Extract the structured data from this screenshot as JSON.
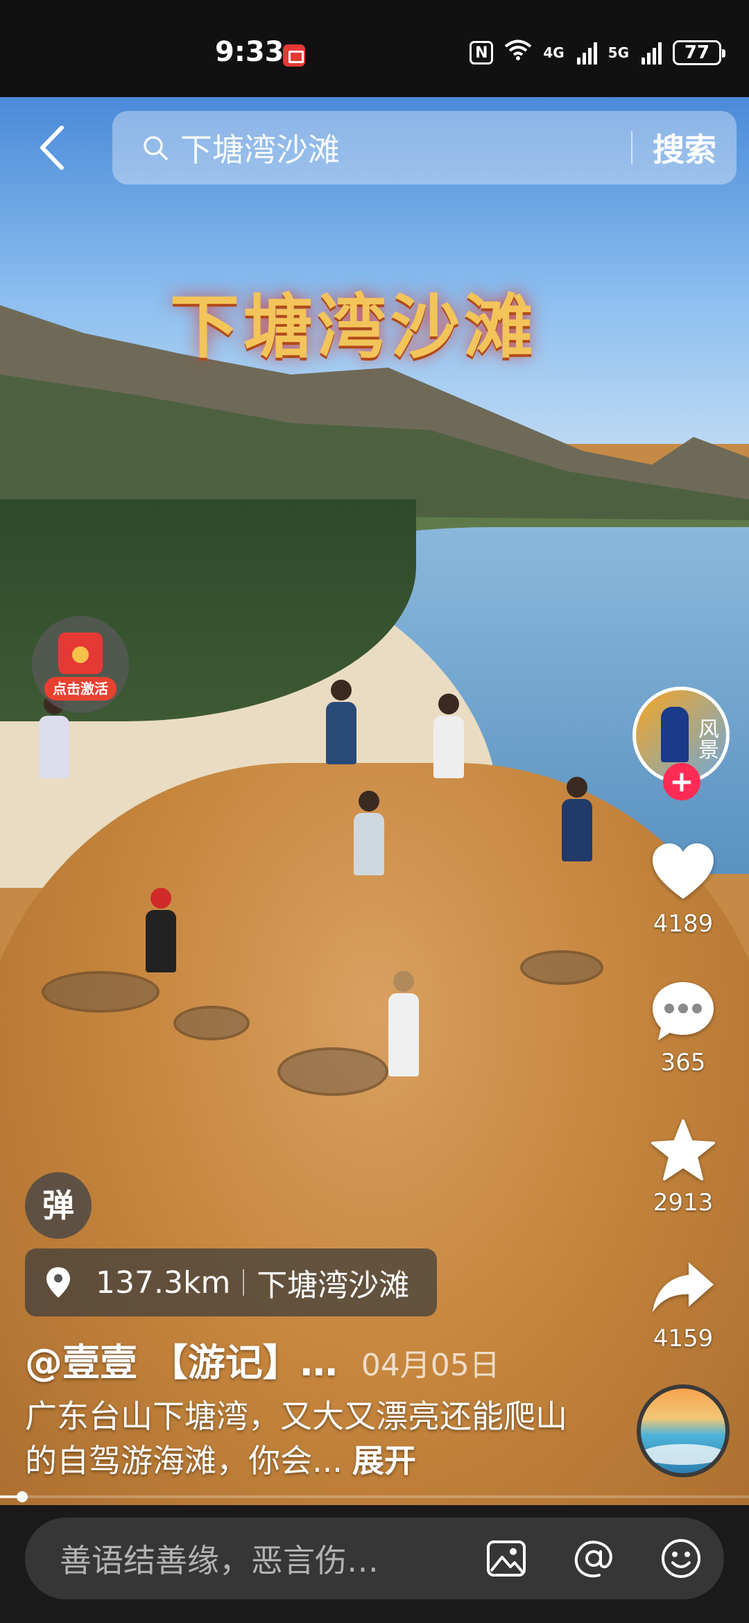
{
  "status_bar": {
    "time": "9:33",
    "net_4g": "4G",
    "net_5g": "5G",
    "battery": "77"
  },
  "search": {
    "query": "下塘湾沙滩",
    "button_label": "搜索"
  },
  "video": {
    "title_overlay": "下塘湾沙滩",
    "red_packet_label": "点击激活"
  },
  "author": {
    "avatar_text": "风景",
    "follow_symbol": "+"
  },
  "rail": {
    "likes": "4189",
    "comments": "365",
    "favorites": "2913",
    "shares": "4159"
  },
  "danmaku_label": "弹",
  "location": {
    "distance": "137.3km",
    "name": "下塘湾沙滩"
  },
  "post": {
    "author_line": "@壹壹 【游记】…",
    "date": "04月05日",
    "caption": "广东台山下塘湾，又大又漂亮还能爬山的自驾游海滩，你会...",
    "expand_label": "展开"
  },
  "progress_percent": 3,
  "comment_bar": {
    "placeholder": "善语结善缘，恶言伤…"
  },
  "icons": [
    "back-arrow-icon",
    "search-icon",
    "heart-icon",
    "comment-icon",
    "star-icon",
    "share-icon",
    "location-pin-icon",
    "image-icon",
    "at-icon",
    "emoji-icon",
    "music-disc-icon"
  ],
  "colors": {
    "accent": "#fe2c55",
    "red_packet": "#e53935",
    "bottom_bar": "#1a1a1a"
  }
}
